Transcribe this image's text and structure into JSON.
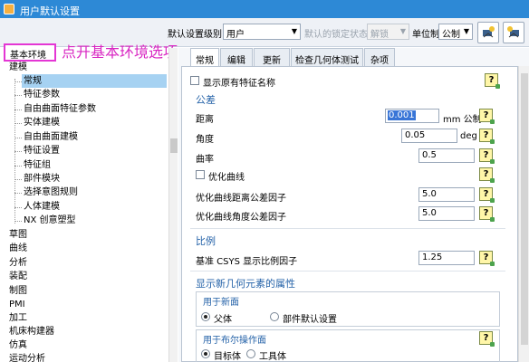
{
  "window": {
    "title": "用户默认设置"
  },
  "toolbar": {
    "level_label": "默认设置级别",
    "level_value": "用户",
    "lock_label": "默认的锁定状态",
    "lock_value": "解锁",
    "unit_label": "单位制",
    "unit_value": "公制"
  },
  "left": {
    "highlight_label": "基本环境",
    "annotation": "点开基本环境选项",
    "items": [
      {
        "label": "建模"
      },
      {
        "label": "常规"
      },
      {
        "label": "特征参数"
      },
      {
        "label": "自由曲面特征参数"
      },
      {
        "label": "实体建模"
      },
      {
        "label": "自由曲面建模"
      },
      {
        "label": "特征设置"
      },
      {
        "label": "特征组"
      },
      {
        "label": "部件模块"
      },
      {
        "label": "选择意图规则"
      },
      {
        "label": "人体建模"
      },
      {
        "label": "NX 创意塑型"
      },
      {
        "label": "草图"
      },
      {
        "label": "曲线"
      },
      {
        "label": "分析"
      },
      {
        "label": "装配"
      },
      {
        "label": "制图"
      },
      {
        "label": "PMI"
      },
      {
        "label": "加工"
      },
      {
        "label": "机床构建器"
      },
      {
        "label": "仿真"
      },
      {
        "label": "运动分析"
      }
    ]
  },
  "tabs": [
    "常规",
    "编辑",
    "更新",
    "检查几何体测试",
    "杂项"
  ],
  "content": {
    "show_names_label": "显示原有特征名称",
    "tolerance_title": "公差",
    "distance_label": "距离",
    "distance_value": "0.001",
    "distance_unit": "mm 公制",
    "angle_label": "角度",
    "angle_value": "0.05",
    "angle_unit": "deg",
    "curvature_label": "曲率",
    "curvature_value": "0.5",
    "optimize_label": "优化曲线",
    "opt_dist_label": "优化曲线距离公差因子",
    "opt_dist_value": "5.0",
    "opt_angle_label": "优化曲线角度公差因子",
    "opt_angle_value": "5.0",
    "scale_title": "比例",
    "csys_label": "基准 CSYS 显示比例因子",
    "csys_value": "1.25",
    "props_title": "显示新几何元素的属性",
    "new_section_label": "用于新面",
    "parent_label": "父体",
    "part_default_label": "部件默认设置",
    "boolean_label": "用于布尔操作面",
    "target_label": "目标体",
    "tool_label": "工具体",
    "help": "?"
  }
}
